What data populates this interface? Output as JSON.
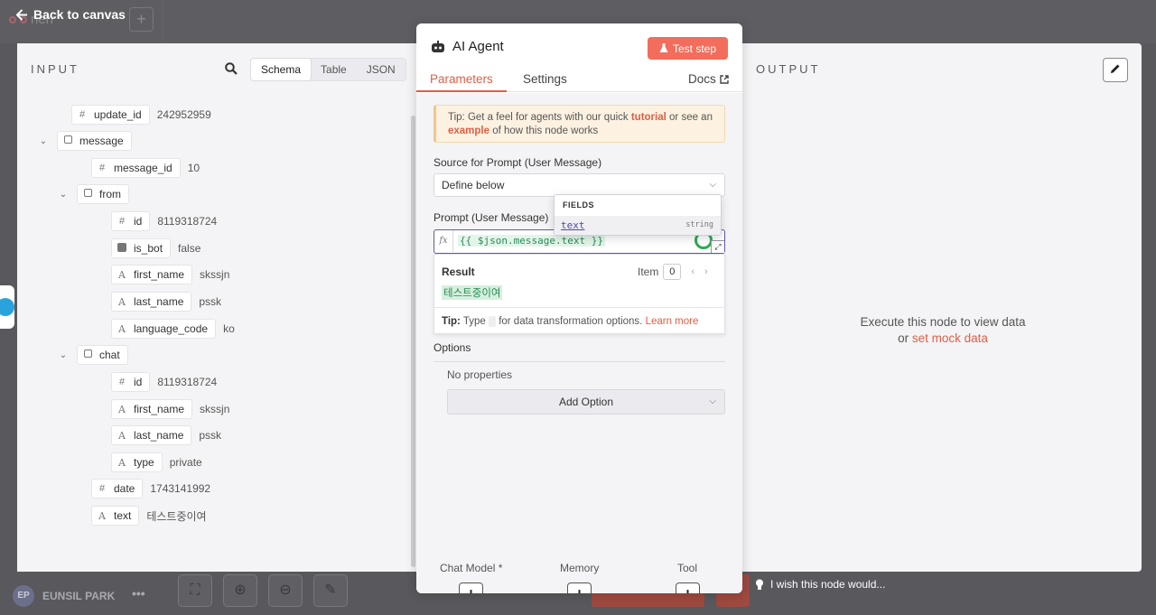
{
  "top": {
    "back_label": "Back to canvas",
    "bg_title": "nerr"
  },
  "bottom": {
    "avatar_initials": "EP",
    "user_name": "EUNSIL PARK",
    "wish_label": "I wish this node would..."
  },
  "input": {
    "title": "INPUT",
    "views": [
      "Schema",
      "Table",
      "JSON"
    ],
    "active_view": "Schema",
    "tree": [
      {
        "key": "update_id",
        "type": "#",
        "value": "242952959"
      },
      {
        "key": "message",
        "type": "object",
        "value": ""
      },
      {
        "key": "message_id",
        "type": "#",
        "value": "10"
      },
      {
        "key": "from",
        "type": "object",
        "value": ""
      },
      {
        "key": "id",
        "type": "#",
        "value": "8119318724"
      },
      {
        "key": "is_bot",
        "type": "bool",
        "value": "false"
      },
      {
        "key": "first_name",
        "type": "A",
        "value": "skssjn"
      },
      {
        "key": "last_name",
        "type": "A",
        "value": "pssk"
      },
      {
        "key": "language_code",
        "type": "A",
        "value": "ko"
      },
      {
        "key": "chat",
        "type": "object",
        "value": ""
      },
      {
        "key": "id",
        "type": "#",
        "value": "8119318724"
      },
      {
        "key": "first_name",
        "type": "A",
        "value": "skssjn"
      },
      {
        "key": "last_name",
        "type": "A",
        "value": "pssk"
      },
      {
        "key": "type",
        "type": "A",
        "value": "private"
      },
      {
        "key": "date",
        "type": "#",
        "value": "1743141992"
      },
      {
        "key": "text",
        "type": "A",
        "value": "테스트중이여"
      }
    ]
  },
  "node": {
    "title": "AI Agent",
    "test_label": "Test step",
    "tabs": [
      "Parameters",
      "Settings"
    ],
    "active_tab": "Parameters",
    "docs_label": "Docs",
    "tip": {
      "pre": "Tip: Get a feel for agents with our quick ",
      "link1": "tutorial",
      "mid": " or see an ",
      "link2": "example",
      "post": " of how this node works"
    },
    "source_label": "Source for Prompt (User Message)",
    "source_value": "Define below",
    "prompt_label": "Prompt (User Message)",
    "prompt_fx": "fx",
    "prompt_value": "{{ $json.message.text }}",
    "result": {
      "title": "Result",
      "item_label": "Item",
      "item_index": "0",
      "value": "테스트중이여",
      "tip_bold": "Tip:",
      "tip_pre": " Type ",
      "tip_post": " for data transformation options. ",
      "tip_link": "Learn more"
    },
    "fields_popup": {
      "header": "FIELDS",
      "name": "text",
      "type": "string"
    },
    "options_title": "Options",
    "no_props": "No properties",
    "add_option_label": "Add Option",
    "connections": [
      "Chat Model *",
      "Memory",
      "Tool"
    ]
  },
  "output": {
    "title": "OUTPUT",
    "msg_line1": "Execute this node to view data",
    "msg_or": "or ",
    "msg_link": "set mock data"
  },
  "colors": {
    "accent": "#e25d45",
    "test_button": "#f26d5b",
    "expression_green": "#2a8a56"
  }
}
